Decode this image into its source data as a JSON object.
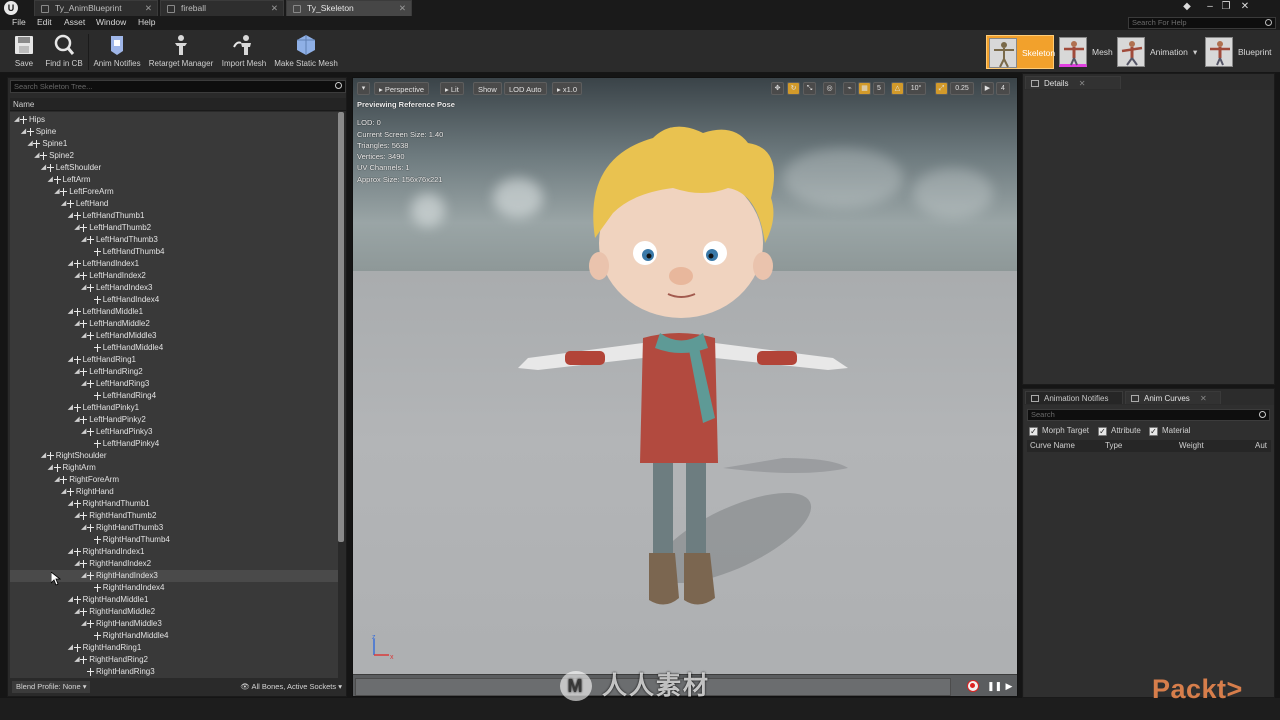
{
  "tabs": [
    {
      "label": "Ty_AnimBlueprint",
      "active": false
    },
    {
      "label": "fireball",
      "active": false
    },
    {
      "label": "Ty_Skeleton",
      "active": true
    }
  ],
  "menu": [
    "File",
    "Edit",
    "Asset",
    "Window",
    "Help"
  ],
  "help_search": {
    "placeholder": "Search For Help"
  },
  "toolbar": {
    "buttons": [
      "Save",
      "Find in CB",
      "Anim Notifies",
      "Retarget Manager",
      "Import Mesh",
      "Make Static Mesh"
    ],
    "modes": [
      "Skeleton",
      "Mesh",
      "Animation",
      "Blueprint"
    ]
  },
  "skeleton_tree": {
    "search_placeholder": "Search Skeleton Tree...",
    "column_header": "Name",
    "bones": [
      {
        "name": "Hips",
        "depth": 0
      },
      {
        "name": "Spine",
        "depth": 1
      },
      {
        "name": "Spine1",
        "depth": 2
      },
      {
        "name": "Spine2",
        "depth": 3
      },
      {
        "name": "LeftShoulder",
        "depth": 4
      },
      {
        "name": "LeftArm",
        "depth": 5
      },
      {
        "name": "LeftForeArm",
        "depth": 6
      },
      {
        "name": "LeftHand",
        "depth": 7
      },
      {
        "name": "LeftHandThumb1",
        "depth": 8
      },
      {
        "name": "LeftHandThumb2",
        "depth": 9
      },
      {
        "name": "LeftHandThumb3",
        "depth": 10
      },
      {
        "name": "LeftHandThumb4",
        "depth": 11
      },
      {
        "name": "LeftHandIndex1",
        "depth": 8
      },
      {
        "name": "LeftHandIndex2",
        "depth": 9
      },
      {
        "name": "LeftHandIndex3",
        "depth": 10
      },
      {
        "name": "LeftHandIndex4",
        "depth": 11
      },
      {
        "name": "LeftHandMiddle1",
        "depth": 8
      },
      {
        "name": "LeftHandMiddle2",
        "depth": 9
      },
      {
        "name": "LeftHandMiddle3",
        "depth": 10
      },
      {
        "name": "LeftHandMiddle4",
        "depth": 11
      },
      {
        "name": "LeftHandRing1",
        "depth": 8
      },
      {
        "name": "LeftHandRing2",
        "depth": 9
      },
      {
        "name": "LeftHandRing3",
        "depth": 10
      },
      {
        "name": "LeftHandRing4",
        "depth": 11
      },
      {
        "name": "LeftHandPinky1",
        "depth": 8
      },
      {
        "name": "LeftHandPinky2",
        "depth": 9
      },
      {
        "name": "LeftHandPinky3",
        "depth": 10
      },
      {
        "name": "LeftHandPinky4",
        "depth": 11
      },
      {
        "name": "RightShoulder",
        "depth": 4
      },
      {
        "name": "RightArm",
        "depth": 5
      },
      {
        "name": "RightForeArm",
        "depth": 6
      },
      {
        "name": "RightHand",
        "depth": 7
      },
      {
        "name": "RightHandThumb1",
        "depth": 8
      },
      {
        "name": "RightHandThumb2",
        "depth": 9
      },
      {
        "name": "RightHandThumb3",
        "depth": 10
      },
      {
        "name": "RightHandThumb4",
        "depth": 11
      },
      {
        "name": "RightHandIndex1",
        "depth": 8
      },
      {
        "name": "RightHandIndex2",
        "depth": 9
      },
      {
        "name": "RightHandIndex3",
        "depth": 10,
        "selected": true
      },
      {
        "name": "RightHandIndex4",
        "depth": 11
      },
      {
        "name": "RightHandMiddle1",
        "depth": 8
      },
      {
        "name": "RightHandMiddle2",
        "depth": 9
      },
      {
        "name": "RightHandMiddle3",
        "depth": 10
      },
      {
        "name": "RightHandMiddle4",
        "depth": 11
      },
      {
        "name": "RightHandRing1",
        "depth": 8
      },
      {
        "name": "RightHandRing2",
        "depth": 9
      },
      {
        "name": "RightHandRing3",
        "depth": 10
      }
    ],
    "blend_profile": "Blend Profile: None",
    "bones_filter": "All Bones, Active Sockets"
  },
  "viewport": {
    "buttons": {
      "perspective": "Perspective",
      "lit": "Lit",
      "show": "Show",
      "lod": "LOD Auto",
      "speed": "x1.0"
    },
    "snap_grid": "5",
    "rotation_snap": "10°",
    "scale_snap": "0.25",
    "camera_speed": "4",
    "info": {
      "title": "Previewing Reference Pose",
      "lines": [
        "LOD: 0",
        "Current Screen Size: 1.40",
        "Triangles: 5638",
        "Vertices: 3490",
        "UV Channels: 1",
        "Approx Size: 156x76x221"
      ]
    },
    "axis": {
      "z": "z",
      "x": "x"
    }
  },
  "details": {
    "tab": "Details"
  },
  "curves_panel": {
    "tabs": [
      "Animation Notifies",
      "Anim Curves"
    ],
    "search_placeholder": "Search",
    "filters": [
      "Morph Target",
      "Attribute",
      "Material"
    ],
    "columns": [
      "Curve Name",
      "Type",
      "Weight",
      "Aut"
    ]
  },
  "watermark": "人人素材",
  "brand": "Packt>"
}
